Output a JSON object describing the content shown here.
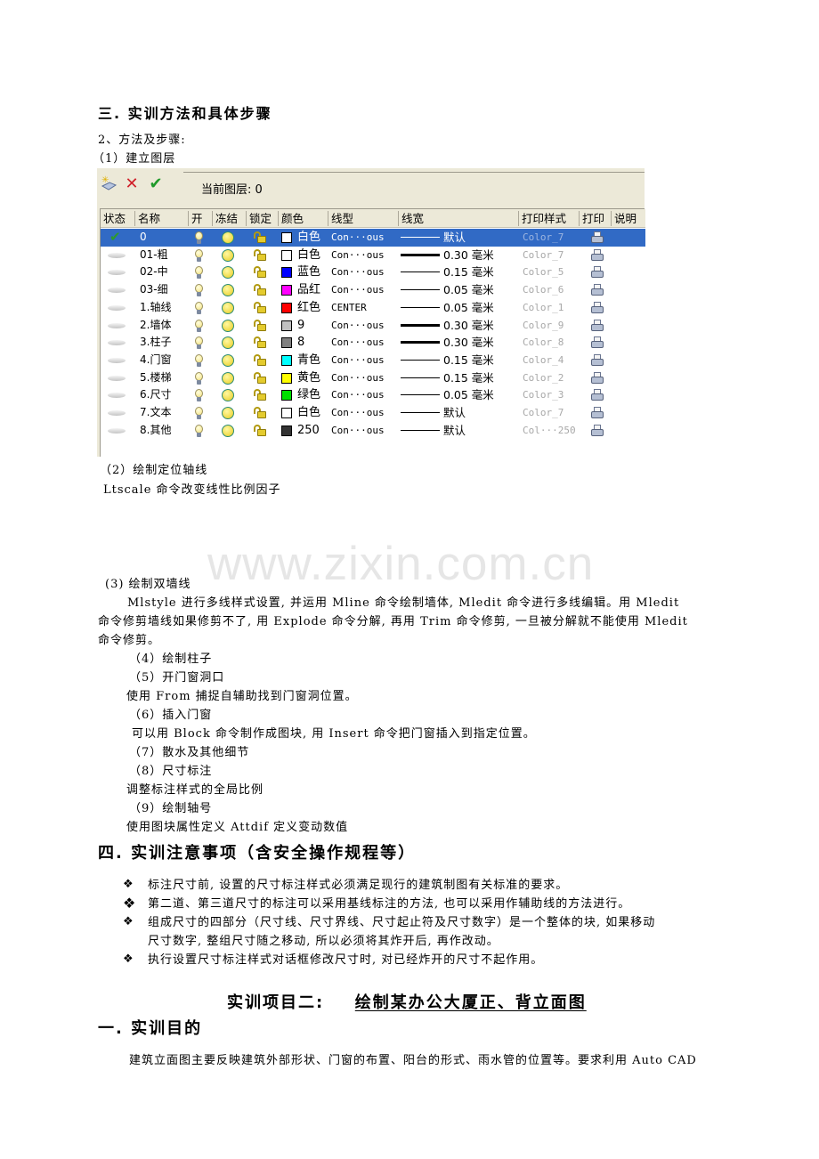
{
  "section3": {
    "heading": "三. 实训方法和具体步骤",
    "method_label": "2、方法及步骤:",
    "step1": "（1）建立图层"
  },
  "layer_manager": {
    "toolbar": {
      "new_layer_icon": "new-layer-icon",
      "delete_layer_icon": "delete-layer-icon",
      "set_current_icon": "set-current-icon",
      "current_layer_label": "当前图层: 0"
    },
    "columns": [
      "状态",
      "名称",
      "开",
      "冻结",
      "锁定",
      "颜色",
      "线型",
      "线宽",
      "打印样式",
      "打印",
      "说明"
    ],
    "rows": [
      {
        "status": "current",
        "name": "0",
        "color_name": "白色",
        "color_hex": "#ffffff",
        "linetype": "Con···ous",
        "lineweight": "默认",
        "lw_heavy": false,
        "plot_style": "Color_7",
        "selected": true
      },
      {
        "status": "normal",
        "name": "01-粗",
        "color_name": "白色",
        "color_hex": "#ffffff",
        "linetype": "Con···ous",
        "lineweight": "0.30 毫米",
        "lw_heavy": true,
        "plot_style": "Color_7",
        "selected": false
      },
      {
        "status": "normal",
        "name": "02-中",
        "color_name": "蓝色",
        "color_hex": "#0000ff",
        "linetype": "Con···ous",
        "lineweight": "0.15 毫米",
        "lw_heavy": false,
        "plot_style": "Color_5",
        "selected": false
      },
      {
        "status": "normal",
        "name": "03-细",
        "color_name": "品红",
        "color_hex": "#ff00ff",
        "linetype": "Con···ous",
        "lineweight": "0.05 毫米",
        "lw_heavy": false,
        "plot_style": "Color_6",
        "selected": false
      },
      {
        "status": "normal",
        "name": "1.轴线",
        "color_name": "红色",
        "color_hex": "#ff0000",
        "linetype": "CENTER",
        "lineweight": "0.05 毫米",
        "lw_heavy": false,
        "plot_style": "Color_1",
        "selected": false
      },
      {
        "status": "normal",
        "name": "2.墙体",
        "color_name": "9",
        "color_hex": "#c0c0c0",
        "linetype": "Con···ous",
        "lineweight": "0.30 毫米",
        "lw_heavy": true,
        "plot_style": "Color_9",
        "selected": false
      },
      {
        "status": "normal",
        "name": "3.柱子",
        "color_name": "8",
        "color_hex": "#808080",
        "linetype": "Con···ous",
        "lineweight": "0.30 毫米",
        "lw_heavy": true,
        "plot_style": "Color_8",
        "selected": false
      },
      {
        "status": "normal",
        "name": "4.门窗",
        "color_name": "青色",
        "color_hex": "#00ffff",
        "linetype": "Con···ous",
        "lineweight": "0.15 毫米",
        "lw_heavy": false,
        "plot_style": "Color_4",
        "selected": false
      },
      {
        "status": "normal",
        "name": "5.楼梯",
        "color_name": "黄色",
        "color_hex": "#ffff00",
        "linetype": "Con···ous",
        "lineweight": "0.15 毫米",
        "lw_heavy": false,
        "plot_style": "Color_2",
        "selected": false
      },
      {
        "status": "normal",
        "name": "6.尺寸",
        "color_name": "绿色",
        "color_hex": "#00e000",
        "linetype": "Con···ous",
        "lineweight": "0.05 毫米",
        "lw_heavy": false,
        "plot_style": "Color_3",
        "selected": false
      },
      {
        "status": "normal",
        "name": "7.文本",
        "color_name": "白色",
        "color_hex": "#ffffff",
        "linetype": "Con···ous",
        "lineweight": "默认",
        "lw_heavy": false,
        "plot_style": "Color_7",
        "selected": false
      },
      {
        "status": "normal",
        "name": "8.其他",
        "color_name": "250",
        "color_hex": "#333333",
        "linetype": "Con···ous",
        "lineweight": "默认",
        "lw_heavy": false,
        "plot_style": "Col···250",
        "selected": false
      }
    ],
    "selection_color": "#316ac5"
  },
  "step2": {
    "title": "（2）绘制定位轴线",
    "text": "Ltscale 命令改变线性比例因子"
  },
  "watermark": "www.zixin.com.cn",
  "step3": {
    "title": "(3) 绘制双墙线",
    "line1": "Mlstyle 进行多线样式设置, 并运用 Mline 命令绘制墙体, Mledit 命令进行多线编辑。用 Mledit",
    "line2": "命令修剪墙线如果修剪不了, 用 Explode 命令分解, 再用 Trim 命令修剪, 一旦被分解就不能使用 Mledit",
    "line3": "命令修剪。"
  },
  "steps": [
    {
      "title": "（4）绘制柱子"
    },
    {
      "title": "（5）开门窗洞口",
      "text": "使用 From 捕捉自辅助找到门窗洞位置。"
    },
    {
      "title": "（6）插入门窗",
      "text": "可以用 Block 命令制作成图块, 用 Insert 命令把门窗插入到指定位置。"
    },
    {
      "title": "（7）散水及其他细节"
    },
    {
      "title": "（8）尺寸标注",
      "text": "调整标注样式的全局比例"
    },
    {
      "title": "（9）绘制轴号",
      "text": "使用图块属性定义 Attdif 定义变动数值"
    }
  ],
  "section4": {
    "heading": "四. 实训注意事项（含安全操作规程等）",
    "bullets": [
      "标注尺寸前, 设置的尺寸标注样式必须满足现行的建筑制图有关标准的要求。",
      "第二道、第三道尺寸的标注可以采用基线标注的方法, 也可以采用作辅助线的方法进行。",
      "组成尺寸的四部分（尺寸线、尺寸界线、尺寸起止符及尺寸数字）是一个整体的块, 如果移动",
      "执行设置尺寸标注样式对话框修改尺寸时, 对已经炸开的尺寸不起作用。"
    ],
    "bullet3_cont": "尺寸数字, 整组尺寸随之移动, 所以必须将其炸开后, 再作改动。"
  },
  "project2": {
    "label": "实训项目二:",
    "title": "绘制某办公大厦正、背立面图"
  },
  "section1": {
    "heading": "一. 实训目的",
    "text": "建筑立面图主要反映建筑外部形状、门窗的布置、阳台的形式、雨水管的位置等。要求利用 Auto CAD"
  }
}
